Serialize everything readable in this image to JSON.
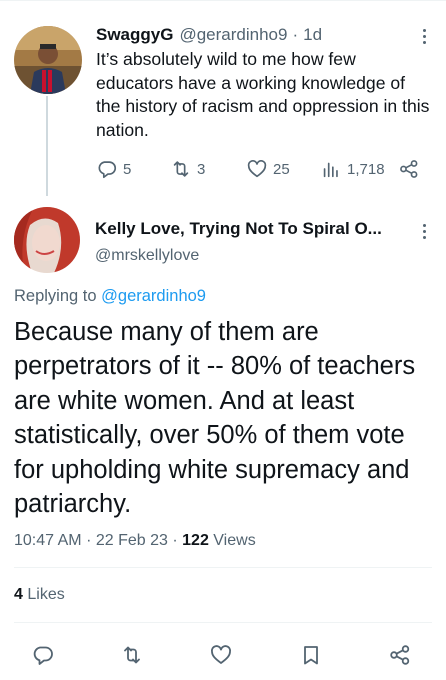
{
  "parent_tweet": {
    "display_name": "SwaggyG",
    "handle": "@gerardinho9",
    "separator": "·",
    "time": "1d",
    "text": "It’s absolutely wild to me how few educators have a working knowledge of the history of racism and oppression in this nation.",
    "replies": "5",
    "retweets": "3",
    "likes": "25",
    "views": "1,718"
  },
  "main_tweet": {
    "display_name": "Kelly Love, Trying Not To Spiral O...",
    "handle": "@mrskellylove",
    "replying_prefix": "Replying to",
    "replying_handle": "@gerardinho9",
    "text": "Because many of them are perpetrators of it -- 80% of teachers are white women. And at least statistically, over 50% of them vote for upholding white supremacy and patriarchy.",
    "time": "10:47 AM",
    "date": "22 Feb 23",
    "separator": "·",
    "views_count": "122",
    "views_label": "Views",
    "likes_count": "4",
    "likes_label": "Likes"
  },
  "icons": {
    "reply": "reply-icon",
    "retweet": "retweet-icon",
    "like": "heart-icon",
    "views": "analytics-icon",
    "share": "share-icon",
    "bookmark": "bookmark-icon",
    "more": "more-icon"
  },
  "colors": {
    "text": "#0f1419",
    "muted": "#536471",
    "link": "#1d9bf0",
    "divider": "#eff3f4",
    "thread_line": "#cfd9de"
  }
}
